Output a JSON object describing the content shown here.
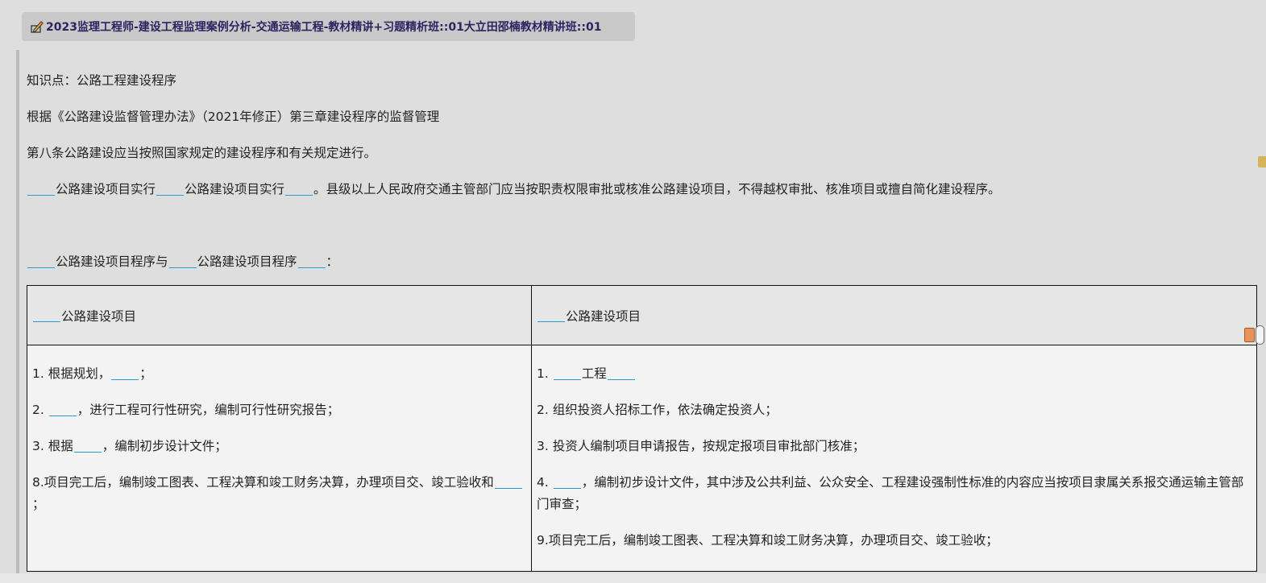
{
  "header": {
    "title": "2023监理工程师-建设工程监理案例分析-交通运输工程-教材精讲+习题精析班::01大立田邵楠教材精讲班::01",
    "icon": "pencil-edit-icon"
  },
  "content": {
    "knowledge_point": "知识点：公路工程建设程序",
    "basis": "根据《公路建设监督管理办法》（2021年修正）第三章建设程序的监督管理",
    "article8": "第八条公路建设应当按照国家规定的建设程序和有关规定进行。",
    "line4": {
      "part1": "公路建设项目实行",
      "part2": "公路建设项目实行",
      "part3": "。县级以上人民政府交通主管部门应当按职责权限审批或核准公路建设项目，不得越权审批、核准项目或擅自简化建设程序。"
    },
    "line5": {
      "part1": "公路建设项目程序与",
      "part2": "公路建设项目程序",
      "part3": "："
    }
  },
  "table": {
    "left_header": "公路建设项目",
    "right_header": "公路建设项目",
    "left_rows": {
      "r1_prefix": "1. 根据规划，",
      "r1_suffix": "；",
      "r2_prefix": "2.",
      "r2_suffix": "，进行工程可行性研究，编制可行性研究报告；",
      "r3_prefix": "3. 根据",
      "r3_suffix": "，编制初步设计文件；",
      "r8_prefix": "8.项目完工后，编制竣工图表、工程决算和竣工财务决算，办理项目交、竣工验收和",
      "r8_suffix": "；"
    },
    "right_rows": {
      "r1_prefix": "1.",
      "r1_mid": "工程",
      "r2": "2. 组织投资人招标工作，依法确定投资人；",
      "r3": "3. 投资人编制项目申请报告，按规定报项目审批部门核准；",
      "r4_prefix": "4.",
      "r4_suffix": "，编制初步设计文件，其中涉及公共利益、公众安全、工程建设强制性标准的内容应当按项目隶属关系报交通运输主管部门审查；",
      "r9": "9.项目完工后，编制竣工图表、工程决算和竣工财务决算，办理项目交、竣工验收；"
    }
  },
  "colors": {
    "blank_underline": "#2a9bd0",
    "title_text": "#2a2460",
    "title_bg": "#c9c9c9"
  }
}
